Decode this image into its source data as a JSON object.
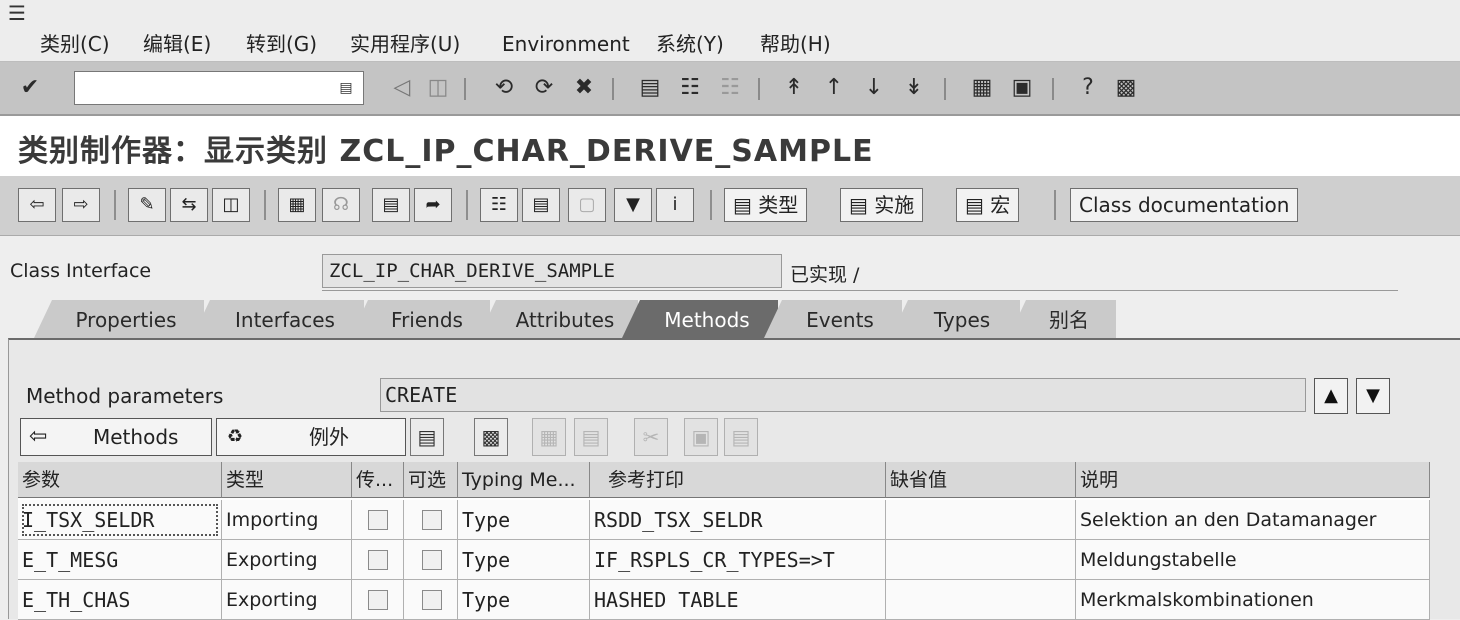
{
  "menu": [
    "类别(C)",
    "编辑(E)",
    "转到(G)",
    "实用程序(U)",
    "Environment",
    "系统(Y)",
    "帮助(H)"
  ],
  "command_field": {
    "value": ""
  },
  "title": "类别制作器：显示类别 ZCL_IP_CHAR_DERIVE_SAMPLE",
  "app_toolbar": {
    "buttons": [
      "类型",
      "实施",
      "宏"
    ],
    "class_doc": "Class documentation"
  },
  "class_interface": {
    "label": "Class Interface",
    "value": "ZCL_IP_CHAR_DERIVE_SAMPLE",
    "status": "已实现 /"
  },
  "tabs": [
    "Properties",
    "Interfaces",
    "Friends",
    "Attributes",
    "Methods",
    "Events",
    "Types",
    "别名"
  ],
  "active_tab": "Methods",
  "method_parameters": {
    "label": "Method parameters",
    "value": "CREATE"
  },
  "sub_toolbar": {
    "methods_label": "Methods",
    "exceptions_label": "例外"
  },
  "table": {
    "columns": [
      "参数",
      "类型",
      "传...",
      "可选",
      "Typing Me...",
      "参考打印",
      "缺省值",
      "说明"
    ],
    "rows": [
      {
        "param": "I_TSX_SELDR",
        "type": "Importing",
        "typing": "Type",
        "ref": "RSDD_TSX_SELDR",
        "default": "",
        "desc": "Selektion an den Datamanager"
      },
      {
        "param": "E_T_MESG",
        "type": "Exporting",
        "typing": "Type",
        "ref": "IF_RSPLS_CR_TYPES=>T",
        "default": "",
        "desc": "Meldungstabelle"
      },
      {
        "param": "E_TH_CHAS",
        "type": "Exporting",
        "typing": "Type",
        "ref": "HASHED TABLE",
        "default": "",
        "desc": "Merkmalskombinationen"
      }
    ]
  }
}
